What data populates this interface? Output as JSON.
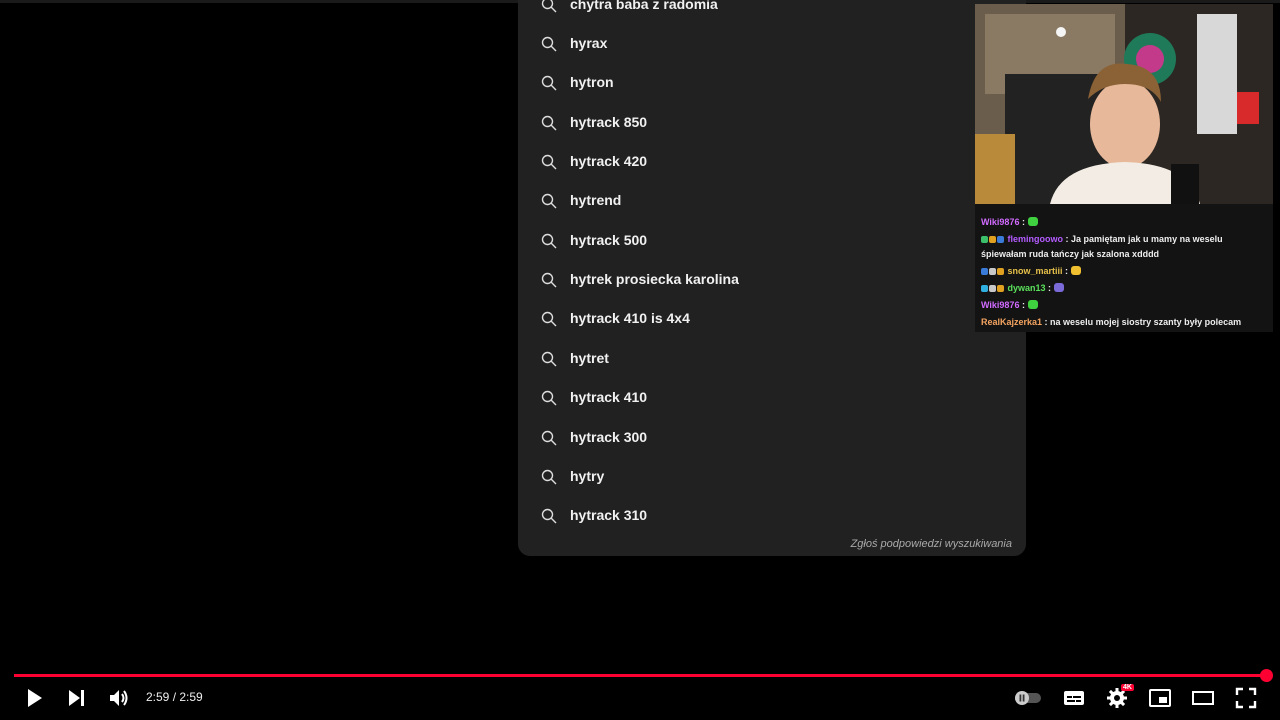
{
  "suggestions": [
    "chytra baba z radomia",
    "hyrax",
    "hytron",
    "hytrack 850",
    "hytrack 420",
    "hytrend",
    "hytrack 500",
    "hytrek prosiecka karolina",
    "hytrack 410 is 4x4",
    "hytret",
    "hytrack 410",
    "hytrack 300",
    "hytry",
    "hytrack 310"
  ],
  "report_link": "Zgłoś podpowiedzi wyszukiwania",
  "chat": [
    {
      "user": "Wiki9876",
      "sep": " :",
      "text": "",
      "color": "#d16bff"
    },
    {
      "user": "flemingoowo",
      "sep": " :",
      "text": " Ja pamiętam jak u mamy na weselu",
      "text2": "śpiewałam ruda tańczy jak szalona xdddd",
      "color": "#b45cff"
    },
    {
      "user": "snow_martiii",
      "sep": " :",
      "text": "",
      "color": "#e6c04a"
    },
    {
      "user": "dywan13",
      "sep": " :",
      "text": "",
      "color": "#5be05b"
    },
    {
      "user": "Wiki9876",
      "sep": " :",
      "text": "",
      "color": "#d16bff"
    },
    {
      "user": "RealKajzerka1",
      "sep": " :",
      "text": " na weselu mojej siostry szanty były polecam",
      "color": "#f4a460"
    }
  ],
  "player": {
    "time": "2:59 / 2:59",
    "progress": 1.0,
    "settings_badge": "4K",
    "accent": "#ff0033"
  }
}
